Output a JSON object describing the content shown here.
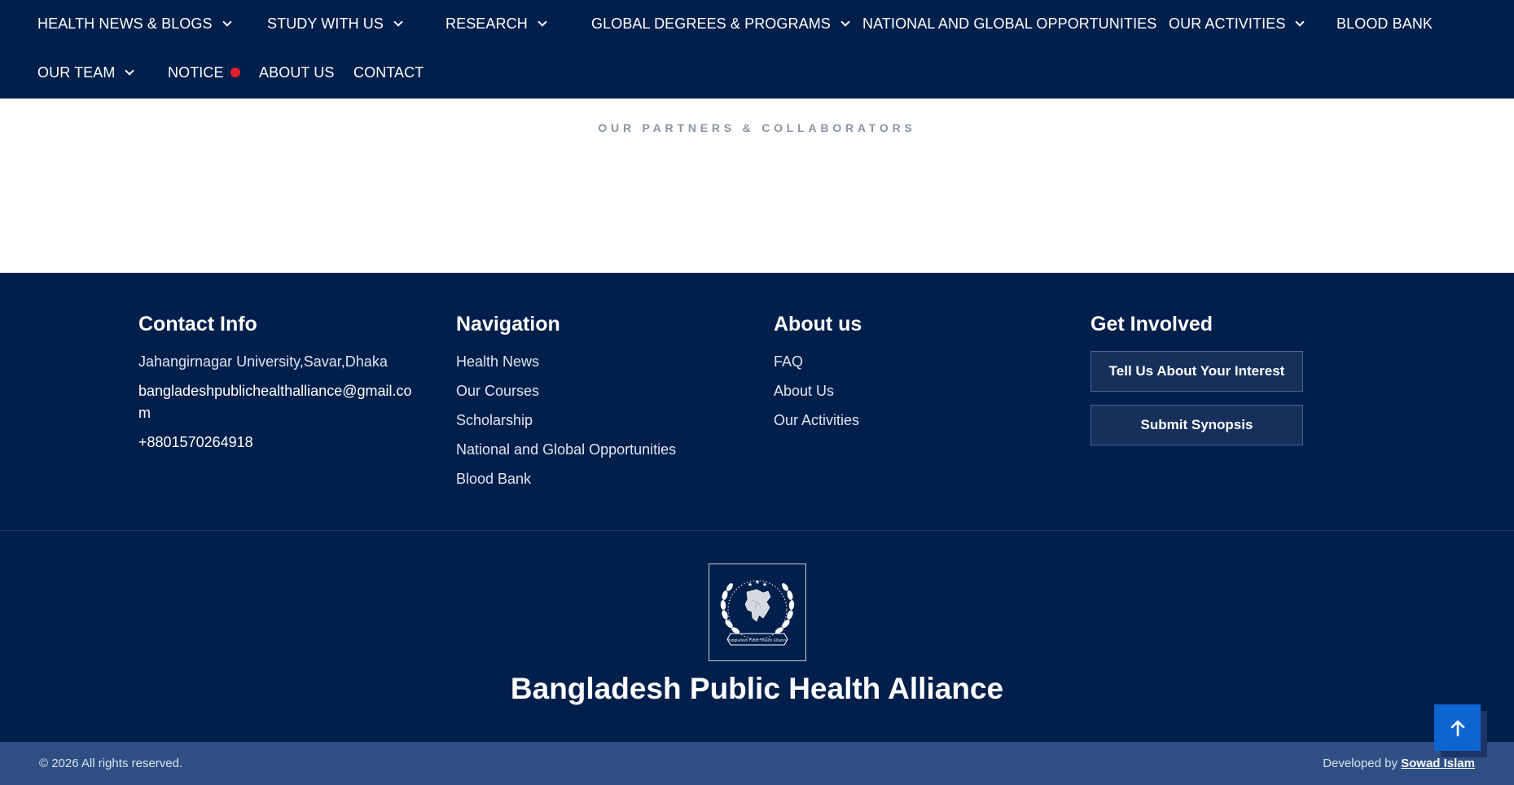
{
  "nav": {
    "row1": [
      {
        "label": "HEALTH NEWS & BLOGS",
        "dropdown": true
      },
      {
        "label": "STUDY WITH US",
        "dropdown": true
      },
      {
        "label": "RESEARCH",
        "dropdown": true
      },
      {
        "label": "GLOBAL DEGREES & PROGRAMS",
        "dropdown": true
      },
      {
        "label": "NATIONAL AND GLOBAL OPPORTUNITIES",
        "dropdown": false
      },
      {
        "label": "OUR ACTIVITIES",
        "dropdown": true
      },
      {
        "label": "BLOOD BANK",
        "dropdown": false
      }
    ],
    "row2": [
      {
        "label": "OUR TEAM",
        "dropdown": true
      },
      {
        "label": "NOTICE",
        "dropdown": false,
        "badge_color": "#e5202e"
      },
      {
        "label": "ABOUT US",
        "dropdown": false
      },
      {
        "label": "CONTACT",
        "dropdown": false
      }
    ]
  },
  "partners": {
    "title": "OUR PARTNERS & COLLABORATORS"
  },
  "footer": {
    "contact": {
      "heading": "Contact Info",
      "address": "Jahangirnagar University,Savar,Dhaka",
      "email": "bangladeshpublichealthalliance@gmail.com",
      "phone": "+8801570264918"
    },
    "navigation": {
      "heading": "Navigation",
      "links": [
        "Health News",
        "Our Courses",
        "Scholarship",
        "National and Global Opportunities",
        "Blood Bank"
      ]
    },
    "about": {
      "heading": "About us",
      "links": [
        "FAQ",
        "About Us",
        "Our Activities"
      ]
    },
    "involved": {
      "heading": "Get Involved",
      "buttons": [
        "Tell Us About Your Interest",
        "Submit Synopsis"
      ]
    },
    "brand": {
      "name": "Bangladesh Public Health Alliance",
      "logo_ribbon_text": "Bangladesh Public Health Alliance"
    }
  },
  "bottom_bar": {
    "copyright": "© 2026 All rights reserved.",
    "credit_prefix": "Developed by",
    "credit_name": "Sowad Islam"
  },
  "icons": {
    "dropdown": "chevron-down-icon",
    "notice_badge": "red-dot-icon",
    "scroll_top": "arrow-up-icon"
  },
  "colors": {
    "navy": "#011f4b",
    "bottom_bar": "#2e4f83",
    "accent_blue": "#0d66d0",
    "notice_dot": "#e5202e"
  }
}
